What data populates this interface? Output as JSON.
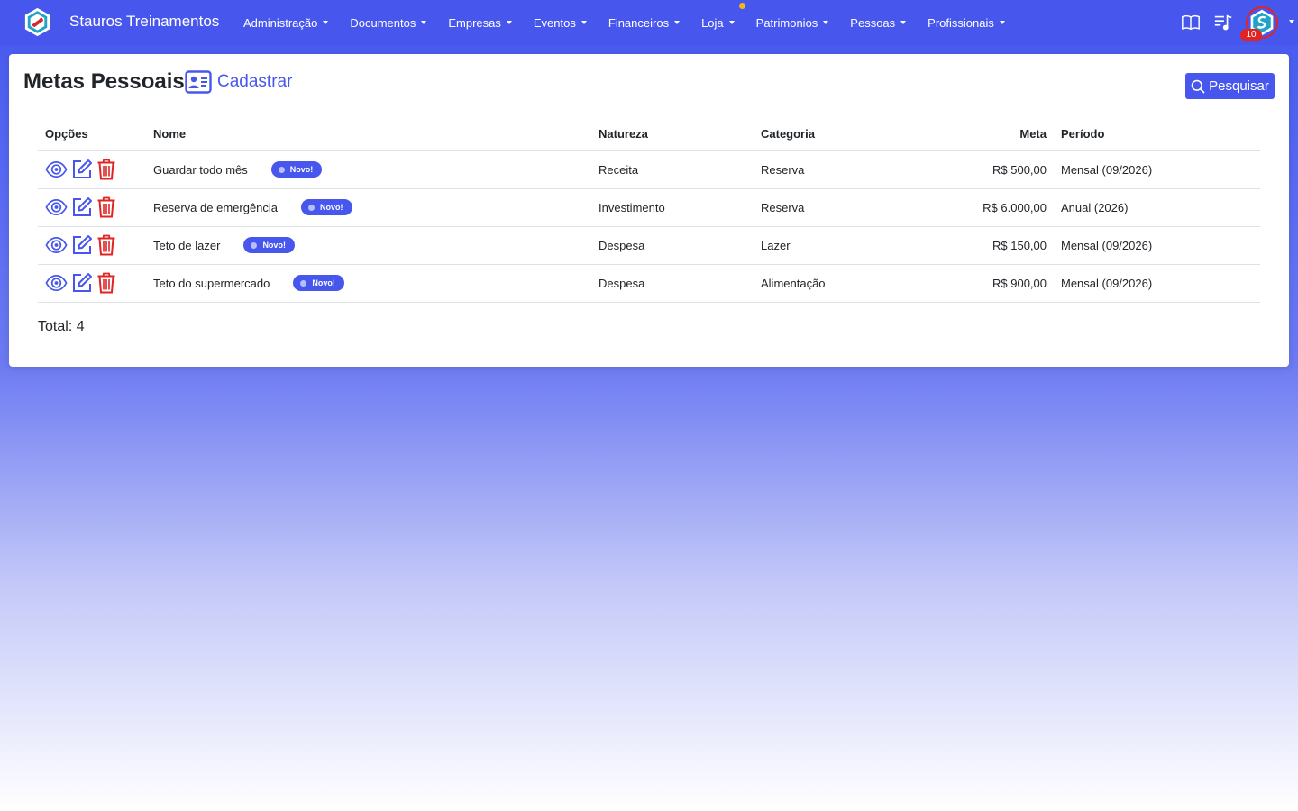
{
  "brand": {
    "name": "Stauros Treinamentos"
  },
  "nav": {
    "items": [
      {
        "label": "Administração"
      },
      {
        "label": "Documentos"
      },
      {
        "label": "Empresas"
      },
      {
        "label": "Eventos"
      },
      {
        "label": "Financeiros"
      },
      {
        "label": "Loja"
      },
      {
        "label": "Patrimonios"
      },
      {
        "label": "Pessoas"
      },
      {
        "label": "Profissionais"
      }
    ],
    "notification_count": "10"
  },
  "page": {
    "title": "Metas Pessoais",
    "register_label": "Cadastrar",
    "search_label": "Pesquisar",
    "total": "Total: 4"
  },
  "table": {
    "headers": {
      "options": "Opções",
      "name": "Nome",
      "nature": "Natureza",
      "category": "Categoria",
      "goal": "Meta",
      "period": "Período"
    },
    "rows": [
      {
        "name": "Guardar todo mês",
        "badge": "Novo!",
        "nature": "Receita",
        "category": "Reserva",
        "goal": "R$ 500,00",
        "period": "Mensal (09/2026)"
      },
      {
        "name": "Reserva de emergência",
        "badge": "Novo!",
        "nature": "Investimento",
        "category": "Reserva",
        "goal": "R$ 6.000,00",
        "period": "Anual (2026)"
      },
      {
        "name": "Teto de lazer",
        "badge": "Novo!",
        "nature": "Despesa",
        "category": "Lazer",
        "goal": "R$ 150,00",
        "period": "Mensal (09/2026)"
      },
      {
        "name": "Teto do supermercado",
        "badge": "Novo!",
        "nature": "Despesa",
        "category": "Alimentação",
        "goal": "R$ 900,00",
        "period": "Mensal (09/2026)"
      }
    ]
  },
  "colors": {
    "primary": "#4757ee",
    "danger": "#e02424",
    "badge_dot": "#f5b718"
  }
}
